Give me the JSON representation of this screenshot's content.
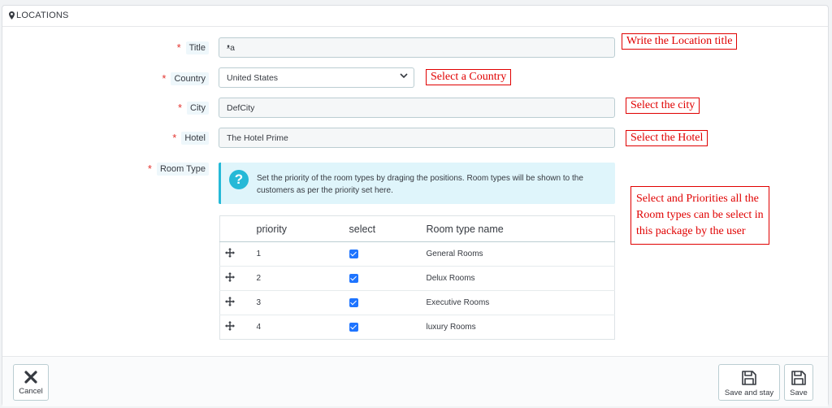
{
  "panel": {
    "title": "LOCATIONS",
    "icon": "map-marker-icon"
  },
  "form": {
    "title": {
      "label": "Title",
      "value": "ᵜa"
    },
    "country": {
      "label": "Country",
      "value": "United States"
    },
    "city": {
      "label": "City",
      "value": "DefCity"
    },
    "hotel": {
      "label": "Hotel",
      "value": "The Hotel Prime"
    },
    "room_type": {
      "label": "Room Type",
      "info": "Set the priority of the room types by draging the positions. Room types will be shown to the customers as per the priority set here.",
      "columns": [
        "priority",
        "select",
        "Room type name"
      ],
      "rows": [
        {
          "priority": "1",
          "selected": true,
          "name": "General Rooms"
        },
        {
          "priority": "2",
          "selected": true,
          "name": "Delux Rooms"
        },
        {
          "priority": "3",
          "selected": true,
          "name": "Executive Rooms"
        },
        {
          "priority": "4",
          "selected": true,
          "name": "luxury Rooms"
        }
      ]
    }
  },
  "annotations": {
    "title": "Write the Location title",
    "country": "Select a Country",
    "city": "Select the city",
    "hotel": "Select the Hotel",
    "room_types": [
      "Select and Priorities all the",
      "Room types can be select in",
      "this package by the user"
    ]
  },
  "footer": {
    "cancel": "Cancel",
    "save_and_stay": "Save and stay",
    "save": "Save"
  },
  "colors": {
    "accent": "#25b9d7",
    "required": "#e3342f",
    "annotation": "#e00000",
    "checkbox": "#1e74ff"
  }
}
